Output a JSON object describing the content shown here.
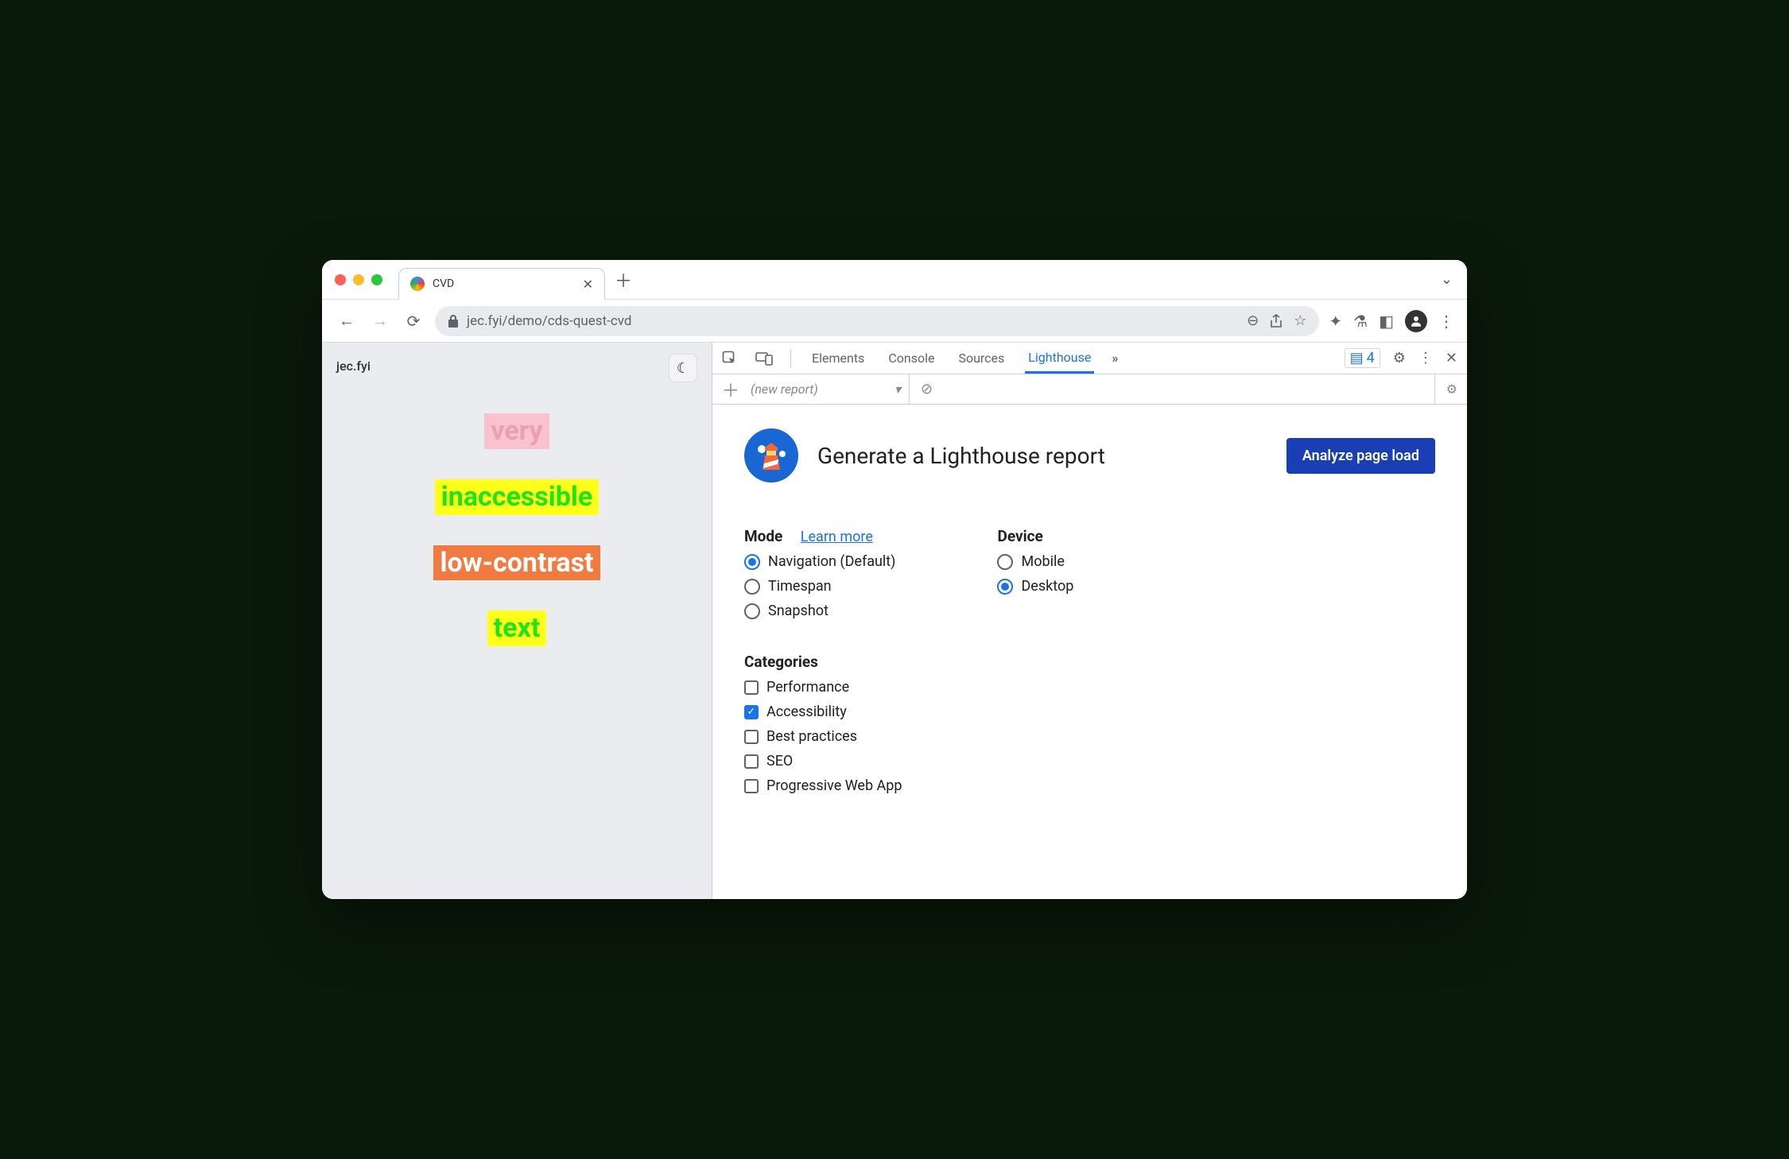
{
  "browser": {
    "tab_title": "CVD",
    "url": "jec.fyi/demo/cds-quest-cvd"
  },
  "page": {
    "brand": "jec.fyi",
    "words": [
      "very",
      "inaccessible",
      "low-contrast",
      "text"
    ]
  },
  "devtools": {
    "tabs": [
      "Elements",
      "Console",
      "Sources",
      "Lighthouse"
    ],
    "active_tab": "Lighthouse",
    "issues_count": "4",
    "new_report_placeholder": "(new report)"
  },
  "lighthouse": {
    "title": "Generate a Lighthouse report",
    "analyze_button": "Analyze page load",
    "mode_label": "Mode",
    "learn_more": "Learn more",
    "modes": [
      {
        "label": "Navigation (Default)",
        "checked": true
      },
      {
        "label": "Timespan",
        "checked": false
      },
      {
        "label": "Snapshot",
        "checked": false
      }
    ],
    "device_label": "Device",
    "devices": [
      {
        "label": "Mobile",
        "checked": false
      },
      {
        "label": "Desktop",
        "checked": true
      }
    ],
    "categories_label": "Categories",
    "categories": [
      {
        "label": "Performance",
        "checked": false
      },
      {
        "label": "Accessibility",
        "checked": true
      },
      {
        "label": "Best practices",
        "checked": false
      },
      {
        "label": "SEO",
        "checked": false
      },
      {
        "label": "Progressive Web App",
        "checked": false
      }
    ]
  }
}
